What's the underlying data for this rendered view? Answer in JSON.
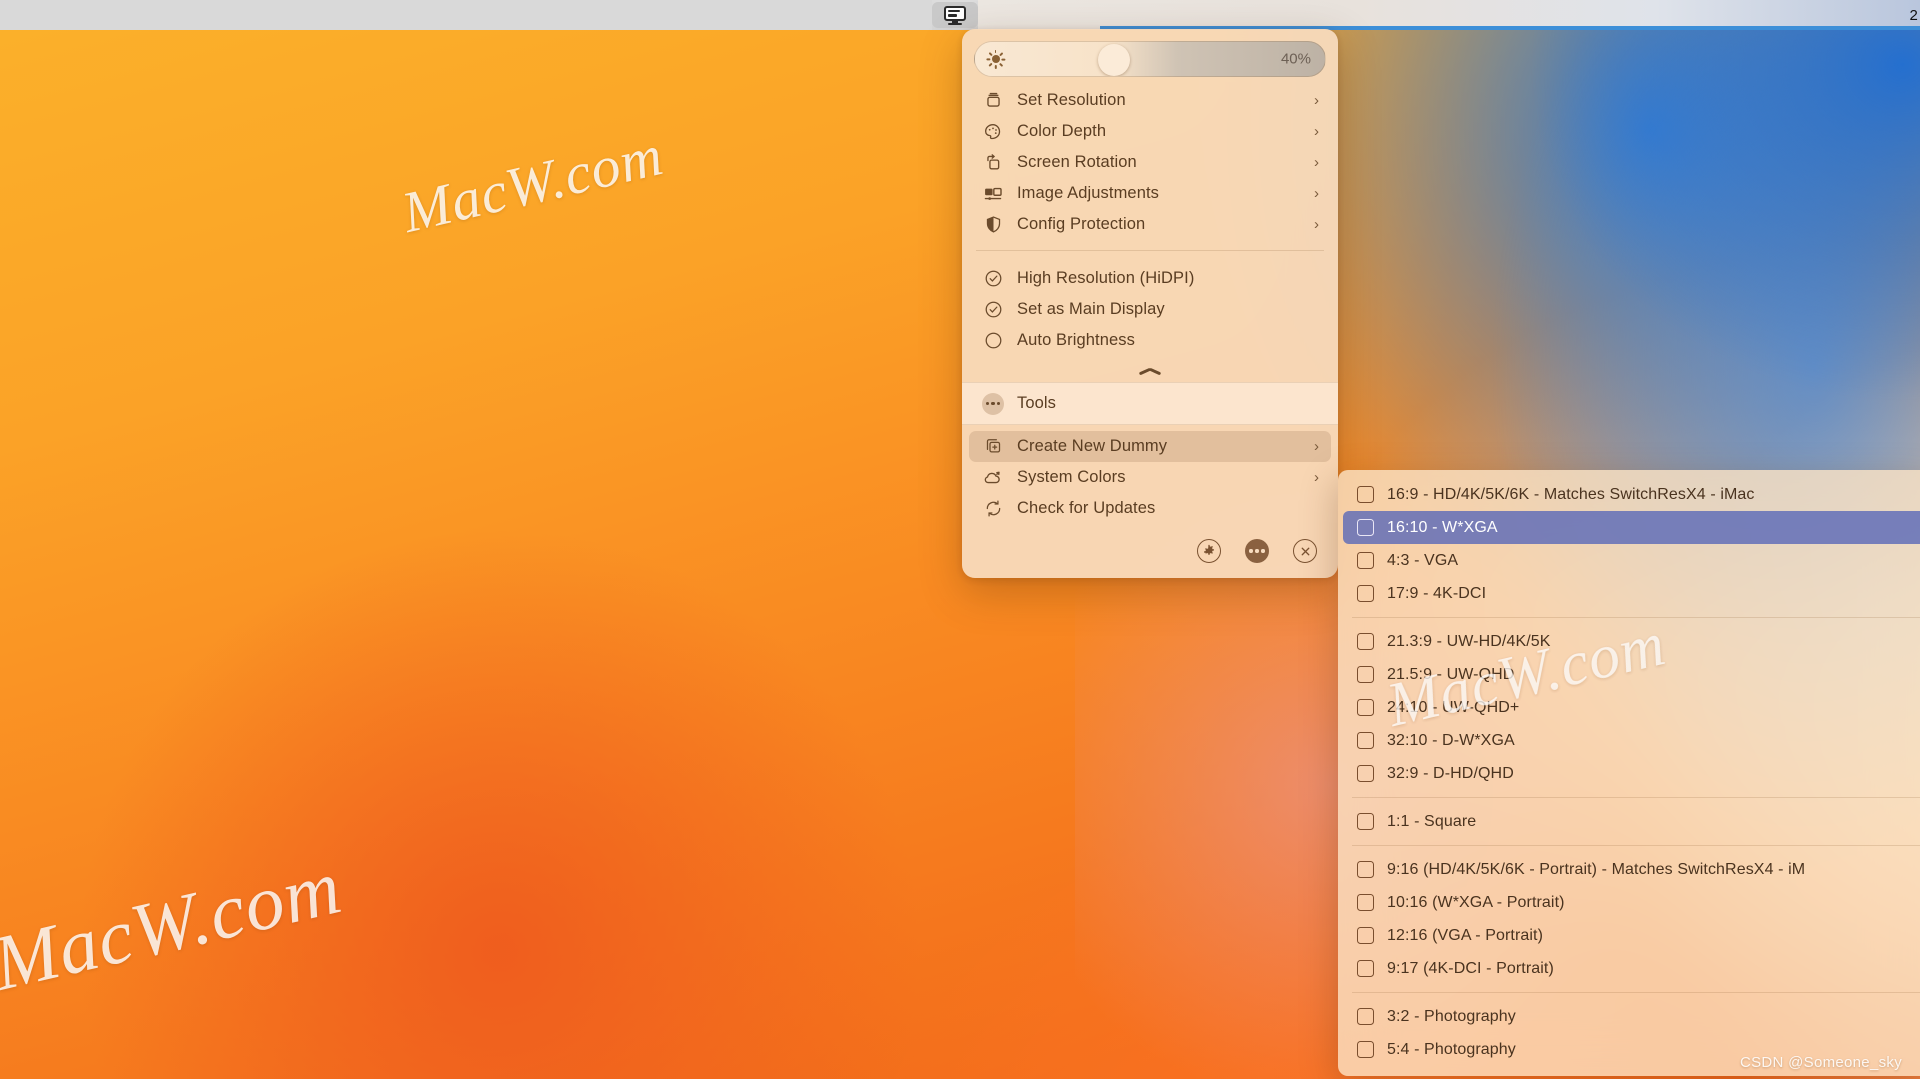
{
  "menubar": {
    "app_icon": "display-icon",
    "clock": "2"
  },
  "panel": {
    "brightness": {
      "icon": "brightness-sun-icon",
      "value_label": "40%",
      "percent": 40
    },
    "groups": [
      {
        "items": [
          {
            "icon": "resolution-icon",
            "label": "Set Resolution",
            "submenu": true,
            "chevron": "›"
          },
          {
            "icon": "palette-icon",
            "label": "Color Depth",
            "submenu": true,
            "chevron": "›"
          },
          {
            "icon": "rotate-screen-icon",
            "label": "Screen Rotation",
            "submenu": true,
            "chevron": "›"
          },
          {
            "icon": "image-adjustments-icon",
            "label": "Image Adjustments",
            "submenu": true,
            "chevron": "›"
          },
          {
            "icon": "shield-icon",
            "label": "Config Protection",
            "submenu": true,
            "chevron": "›"
          }
        ]
      },
      {
        "items": [
          {
            "icon": "check-circle-icon",
            "label": "High Resolution (HiDPI)",
            "checked": true
          },
          {
            "icon": "check-circle-icon",
            "label": "Set as Main Display",
            "checked": true
          },
          {
            "icon": "empty-circle-icon",
            "label": "Auto Brightness",
            "checked": false
          }
        ]
      }
    ],
    "collapse_icon": "chevron-up-icon",
    "tools": {
      "icon": "ellipsis-circle-icon",
      "label": "Tools"
    },
    "actions": [
      {
        "icon": "duplicate-plus-icon",
        "label": "Create New Dummy",
        "submenu": true,
        "chevron": "›",
        "highlighted": true
      },
      {
        "icon": "colors-cloud-icon",
        "label": "System Colors",
        "submenu": true,
        "chevron": "›",
        "highlighted": false
      },
      {
        "icon": "refresh-icon",
        "label": "Check for Updates",
        "submenu": false,
        "chevron": "",
        "highlighted": false
      }
    ],
    "footer_buttons": [
      {
        "icon": "gear-icon",
        "name": "settings-button"
      },
      {
        "icon": "ellipsis-icon",
        "name": "more-button"
      },
      {
        "icon": "close-x-icon",
        "name": "quit-button"
      }
    ]
  },
  "submenu": {
    "title": "Create New Dummy",
    "groups": [
      {
        "items": [
          {
            "label": "16:9 - HD/4K/5K/6K - Matches SwitchResX4 - iMac",
            "checked": false,
            "selected": false
          },
          {
            "label": "16:10 - W*XGA",
            "checked": false,
            "selected": true
          },
          {
            "label": "4:3 - VGA",
            "checked": false,
            "selected": false
          },
          {
            "label": "17:9 - 4K-DCI",
            "checked": false,
            "selected": false
          }
        ]
      },
      {
        "items": [
          {
            "label": "21.3:9 - UW-HD/4K/5K",
            "checked": false,
            "selected": false
          },
          {
            "label": "21.5:9 - UW-QHD",
            "checked": false,
            "selected": false
          },
          {
            "label": "24:10 - UW-QHD+",
            "checked": false,
            "selected": false
          },
          {
            "label": "32:10 - D-W*XGA",
            "checked": false,
            "selected": false
          },
          {
            "label": "32:9 - D-HD/QHD",
            "checked": false,
            "selected": false
          }
        ]
      },
      {
        "items": [
          {
            "label": "1:1 - Square",
            "checked": false,
            "selected": false
          }
        ]
      },
      {
        "items": [
          {
            "label": "9:16 (HD/4K/5K/6K - Portrait) - Matches SwitchResX4 - iM",
            "checked": false,
            "selected": false
          },
          {
            "label": "10:16 (W*XGA - Portrait)",
            "checked": false,
            "selected": false
          },
          {
            "label": "12:16 (VGA - Portrait)",
            "checked": false,
            "selected": false
          },
          {
            "label": "9:17 (4K-DCI - Portrait)",
            "checked": false,
            "selected": false
          }
        ]
      },
      {
        "items": [
          {
            "label": "3:2 - Photography",
            "checked": false,
            "selected": false
          },
          {
            "label": "5:4 - Photography",
            "checked": false,
            "selected": false
          }
        ]
      }
    ]
  },
  "watermarks": {
    "desktop_1": "MacW.com",
    "desktop_2": "MacW.com",
    "overlay_3": "MacW.com",
    "credit": "CSDN @Someone_sky"
  },
  "colors": {
    "panel_bg": "#f7dbbe",
    "panel_text": "#5a3d22",
    "selection_blue": "#5d6ab8",
    "submenu_bg": "#fae2c4",
    "wallpaper_orange": "#f5a623",
    "wallpaper_blue": "#2a74d6"
  }
}
